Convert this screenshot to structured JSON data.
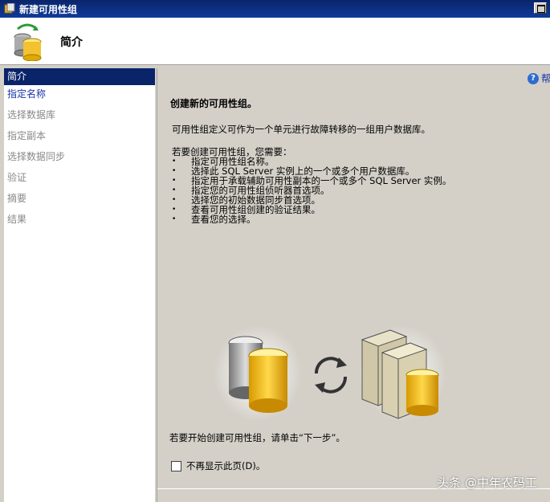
{
  "window": {
    "title": "新建可用性组"
  },
  "header": {
    "title": "简介"
  },
  "sidebar": {
    "items": [
      {
        "label": "简介"
      },
      {
        "label": "指定名称"
      },
      {
        "label": "选择数据库"
      },
      {
        "label": "指定副本"
      },
      {
        "label": "选择数据同步"
      },
      {
        "label": "验证"
      },
      {
        "label": "摘要"
      },
      {
        "label": "结果"
      }
    ]
  },
  "help": {
    "label": "帮"
  },
  "content": {
    "heading": "创建新的可用性组。",
    "description": "可用性组定义可作为一个单元进行故障转移的一组用户数据库。",
    "needs_intro": "若要创建可用性组，您需要：",
    "needs": [
      "指定可用性组名称。",
      "选择此 SQL Server 实例上的一个或多个用户数据库。",
      "指定用于承载辅助可用性副本的一个或多个 SQL Server 实例。",
      "指定您的可用性组侦听器首选项。",
      "选择您的初始数据同步首选项。",
      "查看可用性组创建的验证结果。",
      "查看您的选择。"
    ],
    "start_hint": "若要开始创建可用性组，请单击“下一步”。",
    "dont_show_label": "不再显示此页(D)。"
  },
  "watermark": "头条 @中年农码工",
  "colors": {
    "title_bar": "#0a246a",
    "active_item": "#0a246a",
    "link": "#1a34a8"
  }
}
